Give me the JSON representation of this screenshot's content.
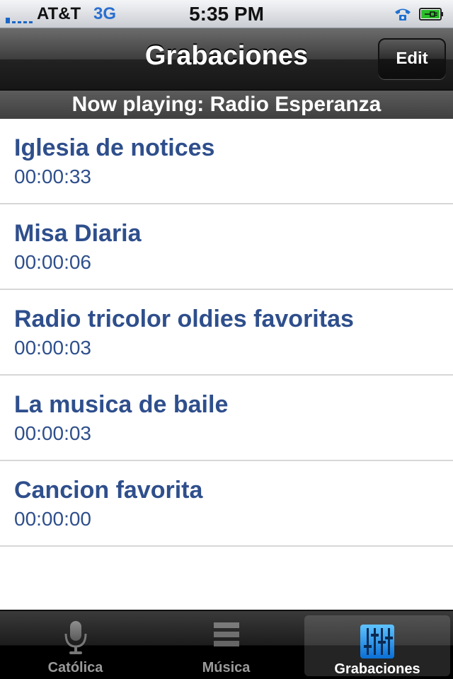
{
  "status_bar": {
    "carrier": "AT&T",
    "network": "3G",
    "time": "5:35 PM"
  },
  "nav_bar": {
    "title": "Grabaciones",
    "edit_label": "Edit"
  },
  "now_playing": "Now playing: Radio Esperanza",
  "recordings": [
    {
      "title": "Iglesia de notices",
      "duration": "00:00:33"
    },
    {
      "title": "Misa Diaria",
      "duration": "00:00:06"
    },
    {
      "title": "Radio tricolor oldies favoritas",
      "duration": "00:00:03"
    },
    {
      "title": "La musica de baile",
      "duration": "00:00:03"
    },
    {
      "title": "Cancion favorita",
      "duration": "00:00:00"
    }
  ],
  "tab_bar": {
    "tabs": [
      {
        "label": "Católica",
        "icon": "microphone-icon",
        "active": false
      },
      {
        "label": "Música",
        "icon": "list-icon",
        "active": false
      },
      {
        "label": "Grabaciones",
        "icon": "equalizer-icon",
        "active": true
      }
    ]
  },
  "colors": {
    "text_blue": "#2f4f8c",
    "active_tab_icon": "#1a8be8"
  }
}
